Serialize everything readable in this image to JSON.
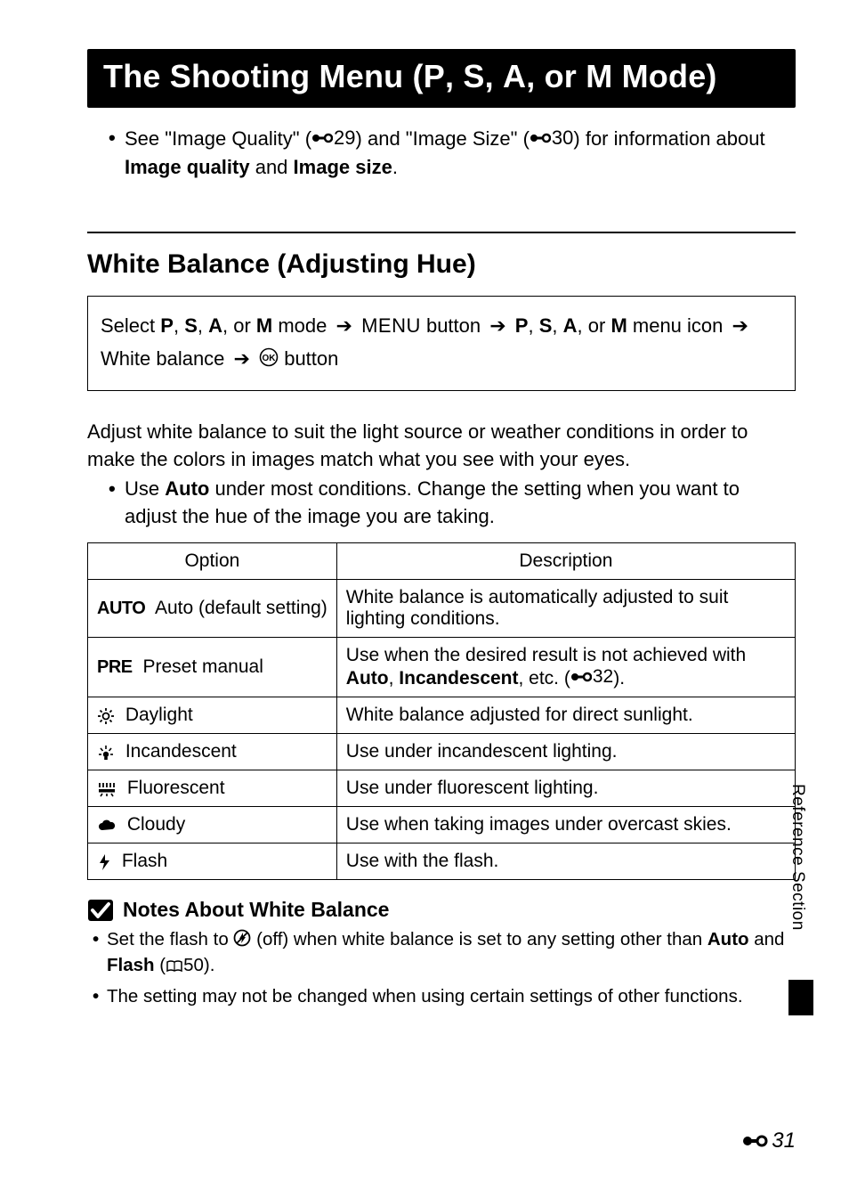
{
  "title": {
    "prefix": "The Shooting Menu (",
    "modes": [
      "P",
      "S",
      "A",
      "M"
    ],
    "suffix": " Mode)"
  },
  "intro": {
    "text_a": "See \"Image Quality\" (",
    "ref_a": "29",
    "text_b": ") and \"Image Size\" (",
    "ref_b": "30",
    "text_c": ") for information about ",
    "bold_a": "Image quality",
    "text_d": " and ",
    "bold_b": "Image size",
    "text_e": "."
  },
  "section_heading": "White Balance (Adjusting Hue)",
  "nav": {
    "select_word": "Select ",
    "modes": [
      "P",
      "S",
      "A",
      "M"
    ],
    "mode_word": " mode ",
    "menu_word": " button ",
    "menu_glyph": "MENU",
    "menu_icon_word": " menu icon ",
    "wb_word": "White balance ",
    "ok_word": " button"
  },
  "body_para": "Adjust white balance to suit the light source or weather conditions in order to make the colors in images match what you see with your eyes.",
  "body_bullet": {
    "a": "Use ",
    "bold": "Auto",
    "b": " under most conditions. Change the setting when you want to adjust the hue of the image you are taking."
  },
  "table": {
    "head_option": "Option",
    "head_desc": "Description",
    "rows": [
      {
        "icon": "AUTO",
        "label": " Auto (default setting)",
        "desc_a": "White balance is automatically adjusted to suit lighting conditions."
      },
      {
        "icon": "PRE",
        "label": " Preset manual",
        "desc_a": "Use when the desired result is not achieved with ",
        "bold_a": "Auto",
        "desc_b": ", ",
        "bold_b": "Incandescent",
        "desc_c": ", etc. (",
        "ref": "32",
        "desc_d": ")."
      },
      {
        "icon": "sun",
        "label": " Daylight",
        "desc_a": "White balance adjusted for direct sunlight."
      },
      {
        "icon": "bulb",
        "label": " Incandescent",
        "desc_a": "Use under incandescent lighting."
      },
      {
        "icon": "fluo",
        "label": " Fluorescent",
        "desc_a": "Use under fluorescent lighting."
      },
      {
        "icon": "cloud",
        "label": " Cloudy",
        "desc_a": "Use when taking images under overcast skies."
      },
      {
        "icon": "flash",
        "label": " Flash",
        "desc_a": "Use with the flash."
      }
    ]
  },
  "notes": {
    "heading": "Notes About White Balance",
    "b1_a": "Set the flash to ",
    "b1_b": " (off) when white balance is set to any setting other than ",
    "b1_bold_a": "Auto",
    "b1_c": " and ",
    "b1_bold_b": "Flash",
    "b1_d": " (",
    "b1_ref": "50",
    "b1_e": ").",
    "b2": "The setting may not be changed when using certain settings of other functions."
  },
  "side_label": "Reference Section",
  "page_number": "31"
}
